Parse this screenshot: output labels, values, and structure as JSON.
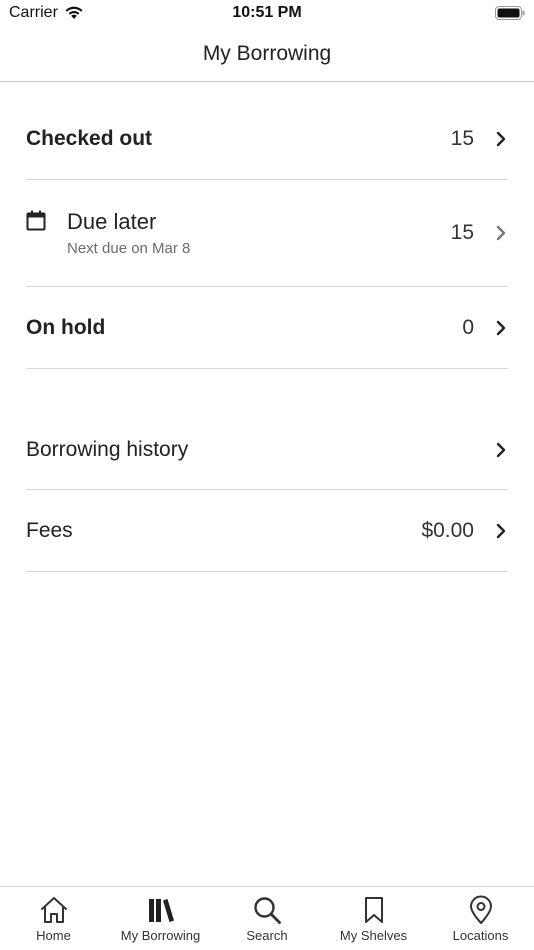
{
  "status_bar": {
    "carrier": "Carrier",
    "time": "10:51 PM"
  },
  "nav": {
    "title": "My Borrowing"
  },
  "rows": {
    "checked_out": {
      "label": "Checked out",
      "count": "15"
    },
    "due_later": {
      "label": "Due later",
      "subtitle": "Next due on Mar 8",
      "count": "15"
    },
    "on_hold": {
      "label": "On hold",
      "count": "0"
    },
    "history": {
      "label": "Borrowing history"
    },
    "fees": {
      "label": "Fees",
      "amount": "$0.00"
    }
  },
  "tabs": [
    {
      "label": "Home",
      "icon": "house-icon"
    },
    {
      "label": "My Borrowing",
      "icon": "books-icon"
    },
    {
      "label": "Search",
      "icon": "magnifier-icon"
    },
    {
      "label": "My Shelves",
      "icon": "bookmark-icon"
    },
    {
      "label": "Locations",
      "icon": "map-pin-icon"
    }
  ],
  "colors": {
    "text": "#222222",
    "secondary_text": "#6b6b6b",
    "divider": "#d6d6d6"
  }
}
